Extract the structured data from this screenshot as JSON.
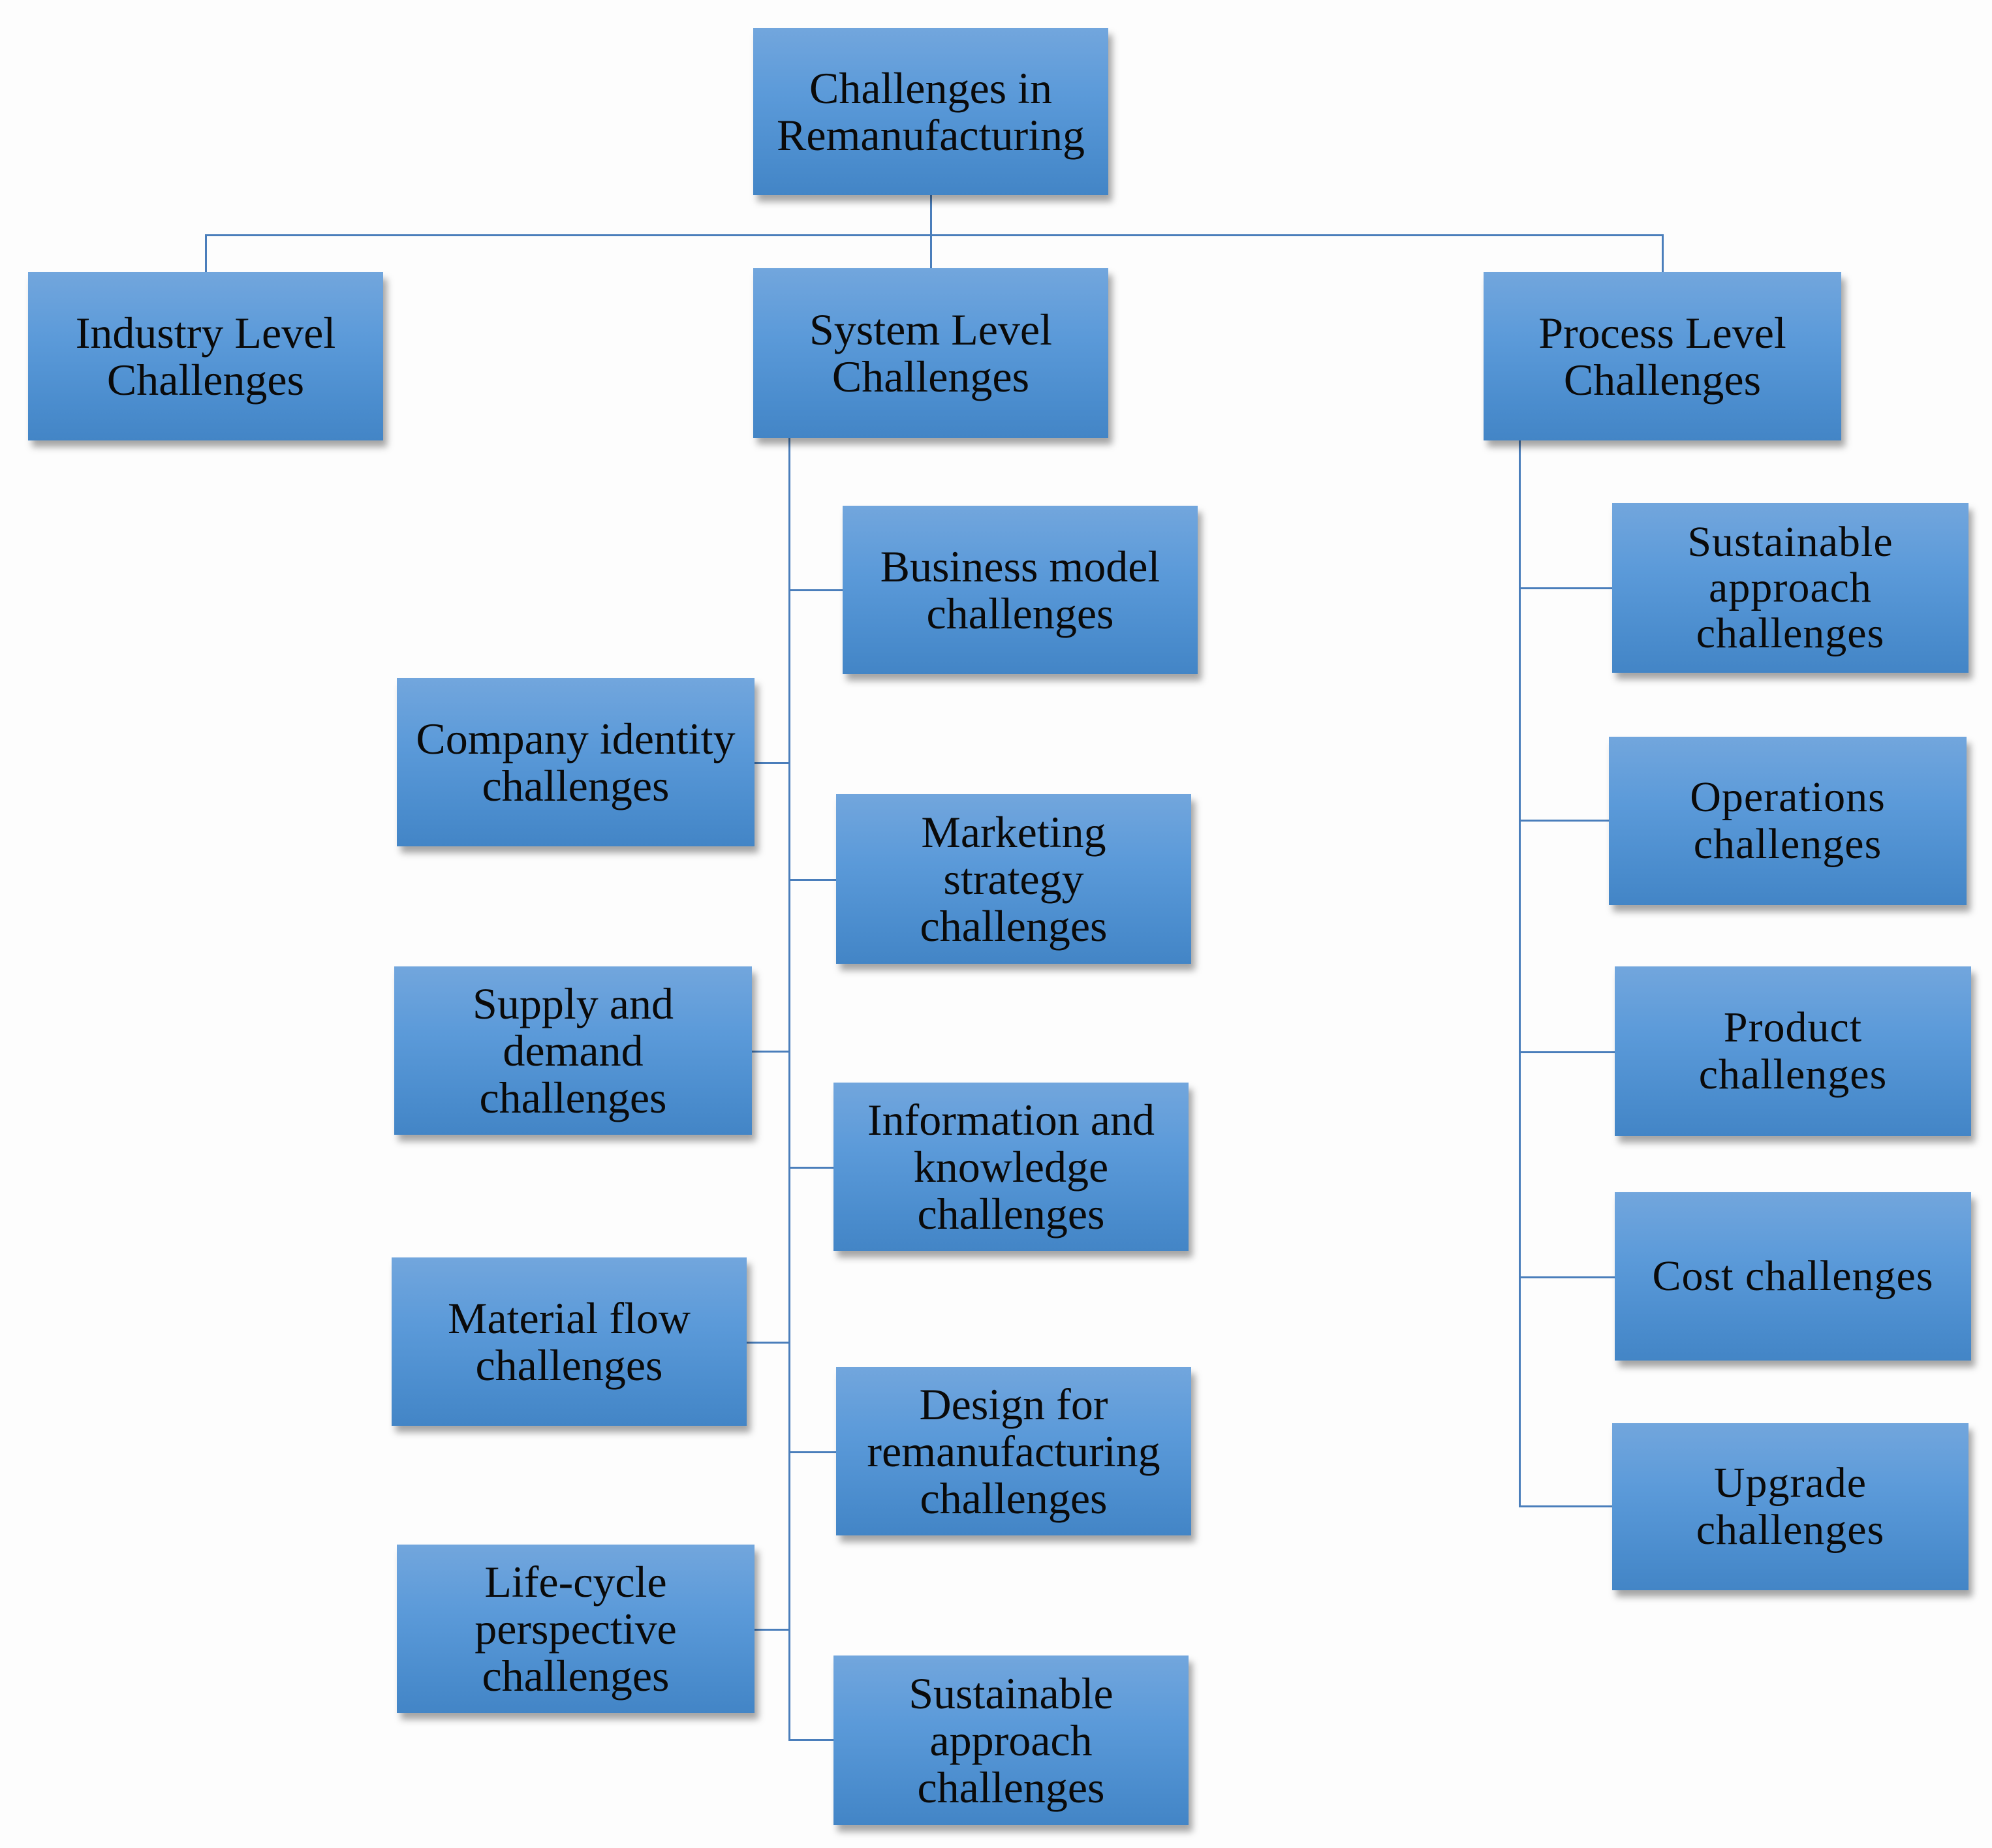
{
  "diagram": {
    "root": {
      "label": "Challenges in\nRemanufacturing"
    },
    "level1": [
      {
        "label": "Industry Level\nChallenges"
      },
      {
        "label": "System Level\nChallenges"
      },
      {
        "label": "Process Level\nChallenges"
      }
    ],
    "system_children": [
      {
        "label": "Business model\nchallenges"
      },
      {
        "label": "Company identity\nchallenges"
      },
      {
        "label": "Marketing\nstrategy\nchallenges"
      },
      {
        "label": "Supply and\ndemand\nchallenges"
      },
      {
        "label": "Information and\nknowledge\nchallenges"
      },
      {
        "label": "Material flow\nchallenges"
      },
      {
        "label": "Design for\nremanufacturing\nchallenges"
      },
      {
        "label": "Life-cycle\nperspective\nchallenges"
      },
      {
        "label": "Sustainable\napproach\nchallenges"
      }
    ],
    "process_children": [
      {
        "label": "Sustainable\napproach\nchallenges"
      },
      {
        "label": "Operations\nchallenges"
      },
      {
        "label": "Product\nchallenges"
      },
      {
        "label": "Cost challenges"
      },
      {
        "label": "Upgrade\nchallenges"
      }
    ],
    "colors": {
      "box_top": "#72a6dd",
      "box_bottom": "#4385c6",
      "connector": "#4a7ebb",
      "text": "#0a0a0a"
    }
  }
}
